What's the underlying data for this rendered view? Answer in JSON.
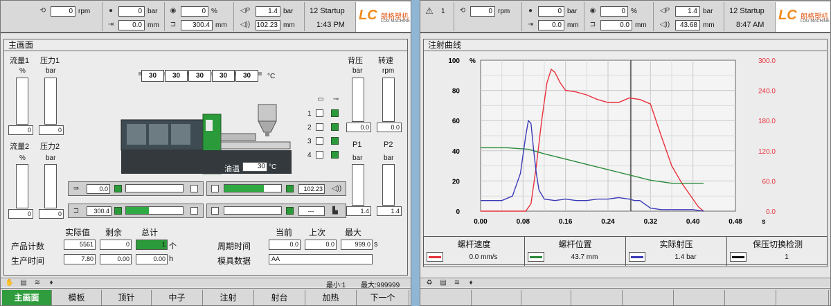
{
  "left": {
    "top": {
      "rpm_value": "0",
      "rpm_unit": "rpm",
      "p_value": "0",
      "p_unit": "bar",
      "v_value": "0",
      "v_unit": "%",
      "fp_value": "1.4",
      "fp_unit": "bar",
      "pos_value": "0.0",
      "pos_unit": "mm",
      "dist_value": "300.4",
      "dist_unit": "mm",
      "inj_value": "102.23",
      "inj_unit": "mm",
      "mode": "12 Startup",
      "time": "1:43 PM",
      "logo_cn": "朗格塑机",
      "logo_en": "LOG MACHINE"
    },
    "title": "主画面",
    "flow1": "流量1",
    "press1": "压力1",
    "flow2": "流量2",
    "press2": "压力2",
    "unit_pct": "%",
    "unit_bar": "bar",
    "unit_rpm": "rpm",
    "flow1_val": "0",
    "press1_val": "0",
    "flow2_val": "0",
    "press2_val": "0",
    "back_pressure": "背压",
    "speed": "转速",
    "back_pressure_val": "0.0",
    "speed_val": "0.0",
    "p1": "P1",
    "p2": "P2",
    "p1_val": "1.4",
    "p2_val": "1.4",
    "temps": [
      "30",
      "30",
      "30",
      "30",
      "30"
    ],
    "temp_unit": "°C",
    "oil_temp_label": "油温",
    "oil_temp_val": "30",
    "oil_unit": "°C",
    "zones": [
      "1",
      "2",
      "3",
      "4"
    ],
    "tray1_left_val": "0.0",
    "tray1_right_val": "102.23",
    "tray2_left_val": "300.4",
    "tray2_right_val": "---",
    "tray1_right_fill": 0.7,
    "tray2_left_fill": 0.4,
    "hdr_actual": "实际值",
    "hdr_remain": "剩余",
    "hdr_total": "总计",
    "row_count": "产品计数",
    "count_actual": "5561",
    "count_remain": "0",
    "count_total": "1",
    "count_unit": "个",
    "row_time": "生产时间",
    "time_actual": "7.80",
    "time_remain": "0.00",
    "time_total": "0.00",
    "time_unit": "h",
    "hdr_current": "当前",
    "hdr_last": "上次",
    "hdr_max": "最大",
    "row_cycle": "周期时间",
    "cycle_current": "0.0",
    "cycle_last": "0.0",
    "cycle_max": "999.0",
    "cycle_unit": "s",
    "row_mold": "模具数据",
    "mold_val": "AA",
    "status_min": "最小:1",
    "status_max": "最大:999999",
    "nav": [
      "主画面",
      "模板",
      "顶针",
      "中子",
      "注射",
      "射台",
      "加热",
      "下一个"
    ]
  },
  "right": {
    "top": {
      "alarm_count": "1",
      "rpm_value": "0",
      "rpm_unit": "rpm",
      "p_value": "0",
      "p_unit": "bar",
      "v_value": "0",
      "v_unit": "%",
      "fp_value": "1.4",
      "fp_unit": "bar",
      "pos_value": "0.0",
      "pos_unit": "mm",
      "dist_value": "0.0",
      "dist_unit": "mm",
      "inj_value": "43.68",
      "inj_unit": "mm",
      "mode": "12 Startup",
      "time": "8:47 AM",
      "logo_cn": "朗格塑机",
      "logo_en": "LOG MACHINE"
    },
    "title": "注射曲线",
    "legend": [
      {
        "name": "螺杆速度",
        "value": "0.0 mm/s",
        "color": "#e8303a"
      },
      {
        "name": "螺杆位置",
        "value": "43.7 mm",
        "color": "#2a8a3a"
      },
      {
        "name": "实际射压",
        "value": "1.4 bar",
        "color": "#3a3ab8"
      },
      {
        "name": "保压切换检测",
        "value": "1",
        "color": "#111111"
      }
    ]
  },
  "chart_data": {
    "type": "line",
    "title": "",
    "xlabel": "s",
    "x_ticks": [
      "0.00",
      "0.08",
      "0.16",
      "0.24",
      "0.32",
      "0.40",
      "0.48"
    ],
    "xlim": [
      0,
      0.48
    ],
    "y_left_label": "%",
    "y_left_ticks": [
      "0",
      "20",
      "40",
      "60",
      "80",
      "100"
    ],
    "y_left_lim": [
      0,
      100
    ],
    "y_right_ticks": [
      "0.0",
      "60.0",
      "120.0",
      "180.0",
      "240.0",
      "300.0"
    ],
    "y_right_lim": [
      0,
      300
    ],
    "cursor_x": 0.283,
    "series": [
      {
        "name": "螺杆速度",
        "color": "#e8303a",
        "x": [
          0,
          0.06,
          0.085,
          0.095,
          0.105,
          0.115,
          0.125,
          0.133,
          0.14,
          0.15,
          0.16,
          0.18,
          0.2,
          0.22,
          0.24,
          0.26,
          0.28,
          0.3,
          0.32,
          0.34,
          0.36,
          0.38,
          0.4,
          0.41,
          0.42
        ],
        "y": [
          0,
          0,
          0,
          5,
          30,
          60,
          85,
          94,
          92,
          85,
          80,
          79,
          77,
          74,
          72,
          72,
          75,
          74,
          71,
          50,
          30,
          18,
          8,
          3,
          0
        ]
      },
      {
        "name": "螺杆位置",
        "color": "#2a8a3a",
        "x": [
          0,
          0.05,
          0.09,
          0.12,
          0.16,
          0.2,
          0.24,
          0.28,
          0.32,
          0.36,
          0.4,
          0.42
        ],
        "y": [
          42,
          42,
          41,
          38,
          34.5,
          31,
          27.5,
          24,
          20.5,
          18.5,
          18.5,
          18.5
        ]
      },
      {
        "name": "实际射压",
        "color": "#3a3ab8",
        "x": [
          0,
          0.04,
          0.06,
          0.075,
          0.085,
          0.09,
          0.095,
          0.1,
          0.105,
          0.11,
          0.12,
          0.14,
          0.16,
          0.18,
          0.2,
          0.22,
          0.24,
          0.26,
          0.28,
          0.29,
          0.3,
          0.32,
          0.34,
          0.36,
          0.38,
          0.4,
          0.42
        ],
        "y": [
          7,
          7,
          10,
          25,
          50,
          60,
          58,
          40,
          25,
          14,
          8,
          7,
          8,
          7,
          7,
          8,
          8,
          9,
          8,
          7,
          7,
          2,
          1,
          1,
          1,
          1,
          0
        ]
      }
    ]
  }
}
